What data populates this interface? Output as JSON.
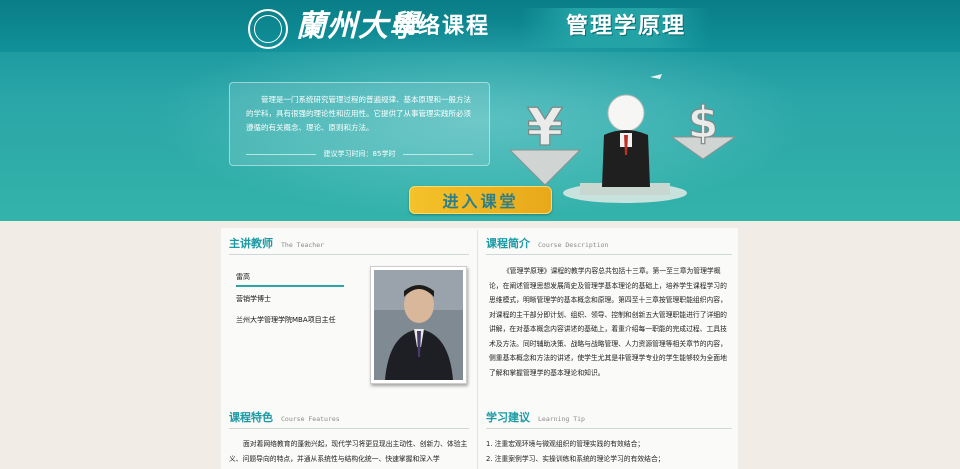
{
  "header": {
    "university": "蘭州大學",
    "site_name": "网络课程",
    "course_title": "管理学原理"
  },
  "intro": {
    "text": "管理是一门系统研究管理过程的普遍规律、基本原理和一般方法的学科，具有很强的理论性和应用性。它提供了从事管理实践所必须遵循的有关概念、理论、原则和方法。",
    "hours": "建议学习时间：85学时"
  },
  "enter_button": {
    "label": "进入课堂"
  },
  "teacher": {
    "heading": "主讲教师",
    "heading_en": "The Teacher",
    "name": "雷高",
    "title": "营销学博士",
    "org": "兰州大学管理学院MBA项目主任"
  },
  "description": {
    "heading": "课程简介",
    "heading_en": "Course Description",
    "text": "《管理学原理》课程的教学内容总共包括十三章。第一至三章为管理学概论，在阐述管理思想发展简史及管理学基本理论的基础上，培养学生课程学习的思维模式，明晰管理学的基本概念和原理。第四至十三章按管理职能组织内容，对课程的主干部分即计划、组织、领导、控制和创新五大管理职能进行了详细的讲解，在对基本概念内容讲述的基础上，着重介绍每一职能的完成过程、工具技术及方法。同时辅助决策、战略与战略管理、人力资源管理等相关章节的内容，侧重基本概念和方法的讲述，使学生尤其是非管理学专业的学生能够较为全面地了解和掌握管理学的基本理论和知识。"
  },
  "features": {
    "heading": "课程特色",
    "heading_en": "Course Features",
    "text": "面对着网络教育的蓬勃兴起，现代学习将更显现出主动性、创新力、体验主义、问题导向的特点，并通从系统性与结构化统一、快速掌握和深入学"
  },
  "tips": {
    "heading": "学习建议",
    "heading_en": "Learning Tip",
    "items": [
      "1. 注重宏观环境与微观组织的管理实践的有效结合；",
      "2. 注重案例学习、实操训练和系统的理论学习的有效结合；"
    ]
  },
  "colors": {
    "accent": "#1a9aa5",
    "hero_teal": "#2aa6a8",
    "button_gold": "#f4c22a"
  },
  "icons": {
    "logo": "university-seal-icon",
    "yuan": "yuan-symbol-icon",
    "dollar": "dollar-symbol-icon"
  }
}
